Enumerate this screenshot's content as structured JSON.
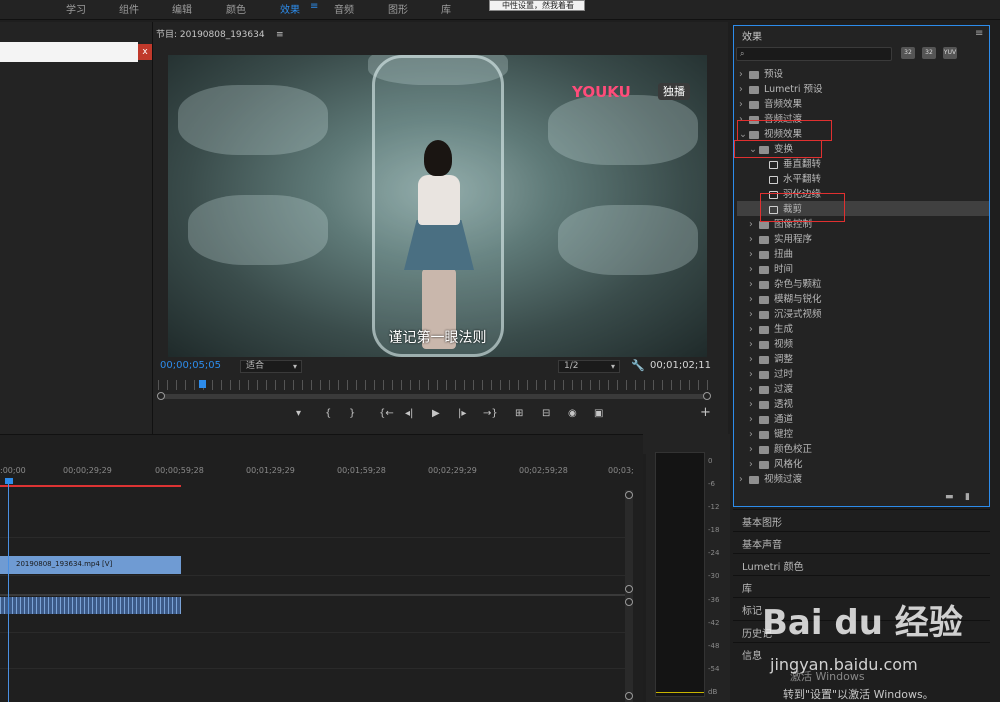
{
  "top_menu": [
    "学习",
    "组件",
    "编辑",
    "颜色",
    "效果",
    "≡",
    "音频",
    "图形",
    "库"
  ],
  "tooltip": "中性设置，然我着看",
  "left_close": "x",
  "program": {
    "title": "节目: 20190808_193634",
    "menu_icon": "≡",
    "timecode_left": "00;00;05;05",
    "fit_label": "适合",
    "resolution": "1/2",
    "timecode_right": "00;01;02;11",
    "subtitle": "谨记第一眼法则",
    "logo_text": "YOUKU",
    "logo_tag": "独播",
    "add_button": "+"
  },
  "transport_icons": [
    "marker-icon",
    "in-point-icon",
    "out-point-icon",
    "go-to-in-icon",
    "step-back-icon",
    "play-icon",
    "step-forward-icon",
    "go-to-out-icon",
    "lift-icon",
    "extract-icon",
    "export-frame-icon",
    "compare-icon"
  ],
  "transport_glyphs": [
    "▾",
    "{",
    "}",
    "{←",
    "◂|",
    "▶",
    "|▸",
    "→}",
    "⊞",
    "⊟",
    "◉",
    "▣"
  ],
  "effects": {
    "title": "效果",
    "menu_icon": "≡",
    "search_icons": [
      "32",
      "32",
      "YUV"
    ],
    "tree": [
      {
        "label": "预设",
        "level": 0,
        "expanded": false,
        "icon": "folder-star"
      },
      {
        "label": "Lumetri 预设",
        "level": 0,
        "expanded": false,
        "icon": "folder-star"
      },
      {
        "label": "音频效果",
        "level": 0,
        "expanded": false,
        "icon": "folder"
      },
      {
        "label": "音频过渡",
        "level": 0,
        "expanded": false,
        "icon": "folder"
      },
      {
        "label": "视频效果",
        "level": 0,
        "expanded": true,
        "icon": "folder"
      },
      {
        "label": "变换",
        "level": 1,
        "expanded": true,
        "icon": "folder"
      },
      {
        "label": "垂直翻转",
        "level": 2,
        "icon": "effect"
      },
      {
        "label": "水平翻转",
        "level": 2,
        "icon": "effect"
      },
      {
        "label": "羽化边缘",
        "level": 2,
        "icon": "effect"
      },
      {
        "label": "裁剪",
        "level": 2,
        "icon": "effect",
        "selected": true
      },
      {
        "label": "图像控制",
        "level": 1,
        "expanded": false,
        "icon": "folder"
      },
      {
        "label": "实用程序",
        "level": 1,
        "expanded": false,
        "icon": "folder"
      },
      {
        "label": "扭曲",
        "level": 1,
        "expanded": false,
        "icon": "folder"
      },
      {
        "label": "时间",
        "level": 1,
        "expanded": false,
        "icon": "folder"
      },
      {
        "label": "杂色与颗粒",
        "level": 1,
        "expanded": false,
        "icon": "folder"
      },
      {
        "label": "模糊与锐化",
        "level": 1,
        "expanded": false,
        "icon": "folder"
      },
      {
        "label": "沉浸式视频",
        "level": 1,
        "expanded": false,
        "icon": "folder"
      },
      {
        "label": "生成",
        "level": 1,
        "expanded": false,
        "icon": "folder"
      },
      {
        "label": "视频",
        "level": 1,
        "expanded": false,
        "icon": "folder"
      },
      {
        "label": "调整",
        "level": 1,
        "expanded": false,
        "icon": "folder"
      },
      {
        "label": "过时",
        "level": 1,
        "expanded": false,
        "icon": "folder"
      },
      {
        "label": "过渡",
        "level": 1,
        "expanded": false,
        "icon": "folder"
      },
      {
        "label": "透视",
        "level": 1,
        "expanded": false,
        "icon": "folder"
      },
      {
        "label": "通道",
        "level": 1,
        "expanded": false,
        "icon": "folder"
      },
      {
        "label": "键控",
        "level": 1,
        "expanded": false,
        "icon": "folder"
      },
      {
        "label": "颜色校正",
        "level": 1,
        "expanded": false,
        "icon": "folder"
      },
      {
        "label": "风格化",
        "level": 1,
        "expanded": false,
        "icon": "folder"
      },
      {
        "label": "视频过渡",
        "level": 0,
        "expanded": false,
        "icon": "folder"
      }
    ]
  },
  "lower_panels": [
    "基本图形",
    "基本声音",
    "Lumetri 颜色",
    "库",
    "标记",
    "历史记",
    "信息"
  ],
  "timeline": {
    "ruler_labels": [
      ":00;00",
      "00;00;29;29",
      "00;00;59;28",
      "00;01;29;29",
      "00;01;59;28",
      "00;02;29;29",
      "00;02;59;28",
      "00;03;"
    ],
    "clip_name": "20190808_193634.mp4 [V]"
  },
  "meter_scale": [
    "0",
    "-6",
    "-12",
    "-18",
    "-24",
    "-30",
    "-36",
    "-42",
    "-48",
    "-54",
    "dB"
  ],
  "watermark": {
    "brand": "Bai du 经验",
    "url": "jingyan.baidu.com"
  },
  "windows_activation": {
    "line1": "激活 Windows",
    "line2": "转到\"设置\"以激活 Windows。"
  },
  "colors": {
    "accent": "#2d8ceb",
    "highlight": "#e03030",
    "clip_video": "#6f9bd3"
  }
}
